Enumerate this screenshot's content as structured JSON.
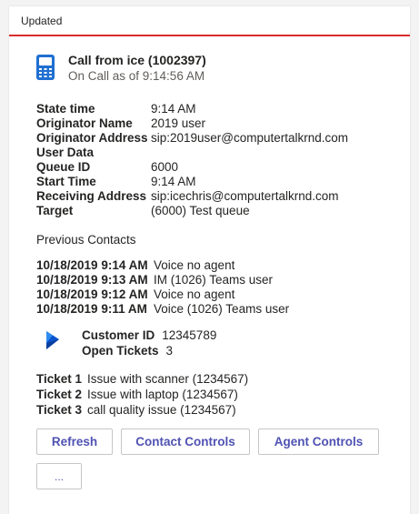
{
  "card": {
    "header": "Updated",
    "accent_color": "#d92b2b"
  },
  "call": {
    "icon": "phone-icon",
    "title": "Call from ice (1002397)",
    "subtitle": "On Call as of 9:14:56 AM"
  },
  "details": [
    {
      "label": "State time",
      "value": "9:14 AM"
    },
    {
      "label": "Originator Name",
      "value": "2019 user"
    },
    {
      "label": "Originator Address",
      "value": "sip:2019user@computertalkrnd.com"
    },
    {
      "label": "User Data",
      "value": ""
    },
    {
      "label": "Queue ID",
      "value": "6000"
    },
    {
      "label": "Start Time",
      "value": "9:14 AM"
    },
    {
      "label": "Receiving Address",
      "value": "sip:icechris@computertalkrnd.com"
    },
    {
      "label": "Target",
      "value": "(6000) Test queue"
    }
  ],
  "previous_contacts": {
    "header": "Previous Contacts",
    "items": [
      {
        "time": "10/18/2019 9:14 AM",
        "desc": "Voice no agent"
      },
      {
        "time": "10/18/2019 9:13 AM",
        "desc": "IM (1026) Teams user"
      },
      {
        "time": "10/18/2019 9:12 AM",
        "desc": "Voice no agent"
      },
      {
        "time": "10/18/2019 9:11 AM",
        "desc": "Voice (1026) Teams user"
      }
    ]
  },
  "customer": {
    "icon": "dynamics-icon",
    "id_label": "Customer ID",
    "id_value": "12345789",
    "tickets_label": "Open Tickets",
    "tickets_value": "3"
  },
  "tickets": [
    {
      "label": "Ticket 1",
      "desc": "Issue with scanner (1234567)"
    },
    {
      "label": "Ticket 2",
      "desc": "Issue with laptop (1234567)"
    },
    {
      "label": "Ticket 3",
      "desc": "call quality issue (1234567)"
    }
  ],
  "buttons": {
    "refresh": "Refresh",
    "contact_controls": "Contact Controls",
    "agent_controls": "Agent Controls",
    "more": "..."
  }
}
